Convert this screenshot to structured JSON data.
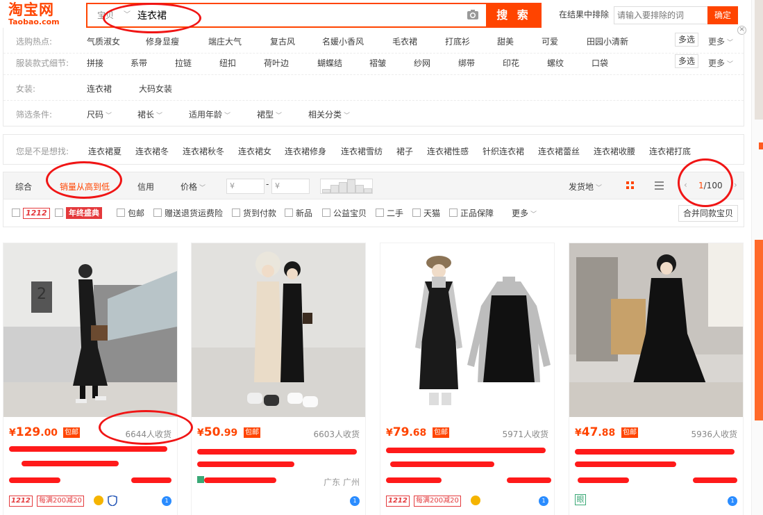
{
  "brand": {
    "logo_cn": "淘宝网",
    "logo_en": "Taobao.com",
    "color": "#ff4400"
  },
  "search": {
    "type_label": "宝贝",
    "query": "连衣裙",
    "button_label": "搜 索",
    "exclude_label": "在结果中排除",
    "exclude_placeholder": "请输入要排除的词",
    "exclude_button": "确定"
  },
  "filters": {
    "hot": {
      "label": "选购热点:",
      "items": [
        "气质淑女",
        "修身显瘦",
        "端庄大气",
        "复古风",
        "名媛小香风",
        "毛衣裙",
        "打底衫",
        "甜美",
        "可爱",
        "田园小清新"
      ],
      "multi": "多选",
      "more": "更多"
    },
    "detail": {
      "label": "服装款式细节:",
      "items": [
        "拼接",
        "系带",
        "拉链",
        "纽扣",
        "荷叶边",
        "蝴蝶结",
        "褶皱",
        "纱网",
        "绑带",
        "印花",
        "螺纹",
        "口袋"
      ],
      "multi": "多选",
      "more": "更多"
    },
    "women": {
      "label": "女装:",
      "items": [
        "连衣裙",
        "大码女装"
      ]
    },
    "conditions": {
      "label": "筛选条件:",
      "items": [
        "尺码",
        "裙长",
        "适用年龄",
        "裙型",
        "相关分类"
      ]
    }
  },
  "suggest": {
    "label": "您是不是想找:",
    "items": [
      "连衣裙夏",
      "连衣裙冬",
      "连衣裙秋冬",
      "连衣裙女",
      "连衣裙修身",
      "连衣裙雪纺",
      "裙子",
      "连衣裙性感",
      "针织连衣裙",
      "连衣裙蕾丝",
      "连衣裙收腰",
      "连衣裙打底"
    ]
  },
  "sortbar": {
    "items": [
      "综合",
      "销量从高到低",
      "信用",
      "价格"
    ],
    "price_min": "¥",
    "price_max": "¥",
    "dash": "-",
    "ship_from": "发货地",
    "page_current": "1",
    "page_total": "/100"
  },
  "checks": {
    "tag_1212": "1212",
    "tag_nianzhong": "年终盛典",
    "items": [
      "包邮",
      "赠送退货运费险",
      "货到付款",
      "新品",
      "公益宝贝",
      "二手",
      "天猫",
      "正品保障"
    ],
    "more": "更多",
    "merge": "合并同款宝贝"
  },
  "products": [
    {
      "price_int": "129",
      "price_dec": ".00",
      "currency": "¥",
      "baoyou": "包邮",
      "sales": "6644人收货",
      "location": "",
      "promo": "每满200减20",
      "tag1212": "1212"
    },
    {
      "price_int": "50",
      "price_dec": ".99",
      "currency": "¥",
      "baoyou": "包邮",
      "sales": "6603人收货",
      "location": "广东 广州",
      "promo": "",
      "tag1212": ""
    },
    {
      "price_int": "79",
      "price_dec": ".68",
      "currency": "¥",
      "baoyou": "包邮",
      "sales": "5971人收货",
      "location": "",
      "promo": "每满200减20",
      "tag1212": "1212"
    },
    {
      "price_int": "47",
      "price_dec": ".88",
      "currency": "¥",
      "baoyou": "包邮",
      "sales": "5936人收货",
      "location": "",
      "promo": "",
      "tag1212": ""
    }
  ],
  "icons": {
    "camera": "camera-icon",
    "close": "close-icon",
    "grid": "grid-view-icon",
    "list": "list-view-icon",
    "wangwang": "wangwang-icon",
    "medal": "medal-icon",
    "shield": "shield-icon"
  },
  "colors": {
    "accent": "#ff4400",
    "annotation": "#f01515",
    "wangwang": "#2a8cff"
  }
}
